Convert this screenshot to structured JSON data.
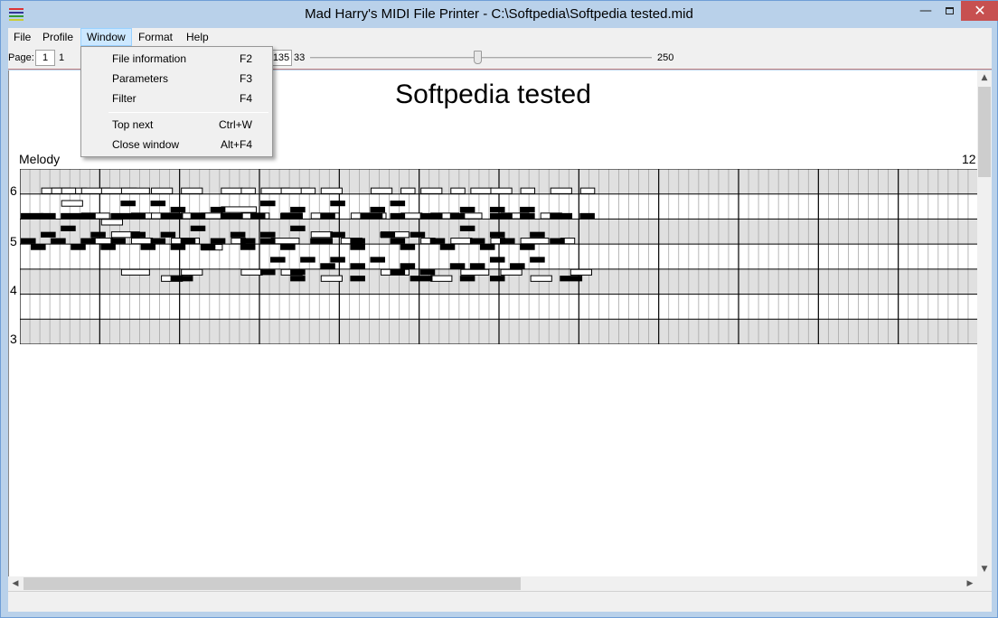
{
  "window": {
    "title": "Mad Harry's MIDI File Printer - C:\\Softpedia\\Softpedia tested.mid",
    "minimize": "—",
    "close": "✕"
  },
  "menu": {
    "file": "File",
    "profile": "Profile",
    "window": "Window",
    "format": "Format",
    "help": "Help"
  },
  "toolbar": {
    "page_label": "Page:",
    "page_value": "1",
    "page_min": "1",
    "zoom_value": "135",
    "zoom_min": "33",
    "zoom_max": "250",
    "zoom_level": 0.49
  },
  "window_menu": {
    "items": [
      {
        "label": "File information",
        "shortcut": "F2"
      },
      {
        "label": "Parameters",
        "shortcut": "F3"
      },
      {
        "label": "Filter",
        "shortcut": "F4"
      },
      {
        "label": "Top next",
        "shortcut": "Ctrl+W"
      },
      {
        "label": "Close window",
        "shortcut": "Alt+F4"
      }
    ]
  },
  "document": {
    "title": "Softpedia tested",
    "track_name": "Melody",
    "page_number": "12",
    "octave_labels": [
      "6",
      "5",
      "4",
      "3"
    ]
  },
  "piano_roll": {
    "measures": 12,
    "beats_per_measure": 8,
    "rows": 28,
    "shaded_bands": [
      0,
      2,
      4,
      6
    ],
    "notes_outline": [
      [
        2,
        3,
        4
      ],
      [
        3,
        3,
        5
      ],
      [
        4,
        3,
        2
      ],
      [
        4,
        5,
        3
      ],
      [
        6,
        3,
        4
      ],
      [
        8,
        3,
        5
      ],
      [
        10,
        3,
        4
      ],
      [
        13,
        3,
        3
      ],
      [
        16,
        3,
        3
      ],
      [
        20,
        3,
        3
      ],
      [
        22,
        3,
        2
      ],
      [
        24,
        3,
        4
      ],
      [
        26,
        3,
        4
      ],
      [
        28,
        3,
        2
      ],
      [
        30,
        3,
        3
      ],
      [
        35,
        3,
        3
      ],
      [
        38,
        3,
        2
      ],
      [
        40,
        3,
        3
      ],
      [
        43,
        3,
        2
      ],
      [
        45,
        3,
        3
      ],
      [
        47,
        3,
        3
      ],
      [
        50,
        3,
        2
      ],
      [
        53,
        3,
        3
      ],
      [
        56,
        3,
        2
      ],
      [
        6,
        7,
        4
      ],
      [
        8,
        8,
        3
      ],
      [
        11,
        7,
        3
      ],
      [
        13,
        7,
        4
      ],
      [
        16,
        7,
        4
      ],
      [
        18,
        7,
        3
      ],
      [
        20,
        6,
        5
      ],
      [
        22,
        7,
        4
      ],
      [
        26,
        7,
        3
      ],
      [
        29,
        7,
        4
      ],
      [
        33,
        7,
        5
      ],
      [
        38,
        7,
        3
      ],
      [
        41,
        7,
        4
      ],
      [
        44,
        7,
        3
      ],
      [
        48,
        7,
        4
      ],
      [
        52,
        7,
        3
      ],
      [
        7,
        11,
        3
      ],
      [
        9,
        10,
        4
      ],
      [
        11,
        11,
        3
      ],
      [
        15,
        11,
        4
      ],
      [
        18,
        12,
        3
      ],
      [
        21,
        11,
        2
      ],
      [
        25,
        11,
        4
      ],
      [
        29,
        10,
        3
      ],
      [
        32,
        11,
        3
      ],
      [
        36,
        10,
        4
      ],
      [
        40,
        11,
        2
      ],
      [
        43,
        11,
        3
      ],
      [
        47,
        11,
        2
      ],
      [
        50,
        11,
        4
      ],
      [
        54,
        11,
        2
      ],
      [
        10,
        16,
        4
      ],
      [
        14,
        17,
        3
      ],
      [
        16,
        16,
        3
      ],
      [
        22,
        16,
        3
      ],
      [
        26,
        16,
        3
      ],
      [
        30,
        17,
        3
      ],
      [
        36,
        16,
        4
      ],
      [
        41,
        17,
        3
      ],
      [
        44,
        16,
        4
      ],
      [
        48,
        16,
        3
      ],
      [
        51,
        17,
        3
      ],
      [
        55,
        16,
        3
      ]
    ],
    "notes_solid": [
      [
        0,
        7,
        3
      ],
      [
        2,
        7,
        2
      ],
      [
        4,
        7,
        3
      ],
      [
        6,
        7,
        2
      ],
      [
        9,
        7,
        3
      ],
      [
        11,
        7,
        2
      ],
      [
        14,
        7,
        3
      ],
      [
        17,
        7,
        2
      ],
      [
        20,
        7,
        3
      ],
      [
        23,
        7,
        2
      ],
      [
        26,
        7,
        3
      ],
      [
        30,
        7,
        2
      ],
      [
        34,
        7,
        3
      ],
      [
        37,
        7,
        2
      ],
      [
        40,
        7,
        3
      ],
      [
        43,
        7,
        2
      ],
      [
        47,
        7,
        3
      ],
      [
        50,
        7,
        2
      ],
      [
        53,
        7,
        3
      ],
      [
        56,
        7,
        2
      ],
      [
        10,
        5,
        2
      ],
      [
        13,
        5,
        2
      ],
      [
        15,
        6,
        2
      ],
      [
        19,
        6,
        2
      ],
      [
        24,
        5,
        2
      ],
      [
        27,
        6,
        2
      ],
      [
        31,
        5,
        2
      ],
      [
        35,
        6,
        2
      ],
      [
        37,
        5,
        2
      ],
      [
        44,
        6,
        2
      ],
      [
        47,
        6,
        2
      ],
      [
        50,
        6,
        2
      ],
      [
        2,
        10,
        2
      ],
      [
        4,
        9,
        2
      ],
      [
        7,
        10,
        2
      ],
      [
        11,
        10,
        2
      ],
      [
        14,
        10,
        2
      ],
      [
        17,
        9,
        2
      ],
      [
        21,
        10,
        2
      ],
      [
        24,
        10,
        2
      ],
      [
        27,
        9,
        2
      ],
      [
        31,
        10,
        2
      ],
      [
        36,
        10,
        2
      ],
      [
        39,
        10,
        2
      ],
      [
        44,
        9,
        2
      ],
      [
        47,
        10,
        2
      ],
      [
        51,
        10,
        2
      ],
      [
        0,
        11,
        2
      ],
      [
        3,
        11,
        2
      ],
      [
        6,
        11,
        2
      ],
      [
        9,
        11,
        2
      ],
      [
        13,
        11,
        2
      ],
      [
        16,
        11,
        2
      ],
      [
        19,
        11,
        2
      ],
      [
        22,
        11,
        2
      ],
      [
        24,
        11,
        2
      ],
      [
        29,
        11,
        3
      ],
      [
        33,
        11,
        2
      ],
      [
        37,
        11,
        2
      ],
      [
        41,
        11,
        2
      ],
      [
        45,
        11,
        2
      ],
      [
        48,
        11,
        2
      ],
      [
        53,
        11,
        2
      ],
      [
        1,
        12,
        2
      ],
      [
        5,
        12,
        2
      ],
      [
        8,
        12,
        2
      ],
      [
        12,
        12,
        2
      ],
      [
        15,
        12,
        2
      ],
      [
        18,
        12,
        2
      ],
      [
        22,
        12,
        2
      ],
      [
        26,
        12,
        2
      ],
      [
        33,
        12,
        2
      ],
      [
        38,
        12,
        2
      ],
      [
        42,
        12,
        2
      ],
      [
        46,
        12,
        2
      ],
      [
        50,
        12,
        2
      ],
      [
        25,
        14,
        2
      ],
      [
        28,
        14,
        2
      ],
      [
        31,
        14,
        2
      ],
      [
        35,
        14,
        2
      ],
      [
        38,
        15,
        2
      ],
      [
        43,
        15,
        2
      ],
      [
        47,
        14,
        2
      ],
      [
        51,
        14,
        2
      ],
      [
        24,
        16,
        2
      ],
      [
        27,
        16,
        2
      ],
      [
        30,
        15,
        2
      ],
      [
        33,
        15,
        2
      ],
      [
        37,
        16,
        2
      ],
      [
        40,
        16,
        2
      ],
      [
        45,
        15,
        2
      ],
      [
        49,
        15,
        2
      ],
      [
        15,
        17,
        3
      ],
      [
        27,
        17,
        2
      ],
      [
        33,
        17,
        2
      ],
      [
        39,
        17,
        3
      ],
      [
        44,
        17,
        2
      ],
      [
        47,
        17,
        2
      ],
      [
        54,
        17,
        3
      ]
    ]
  }
}
